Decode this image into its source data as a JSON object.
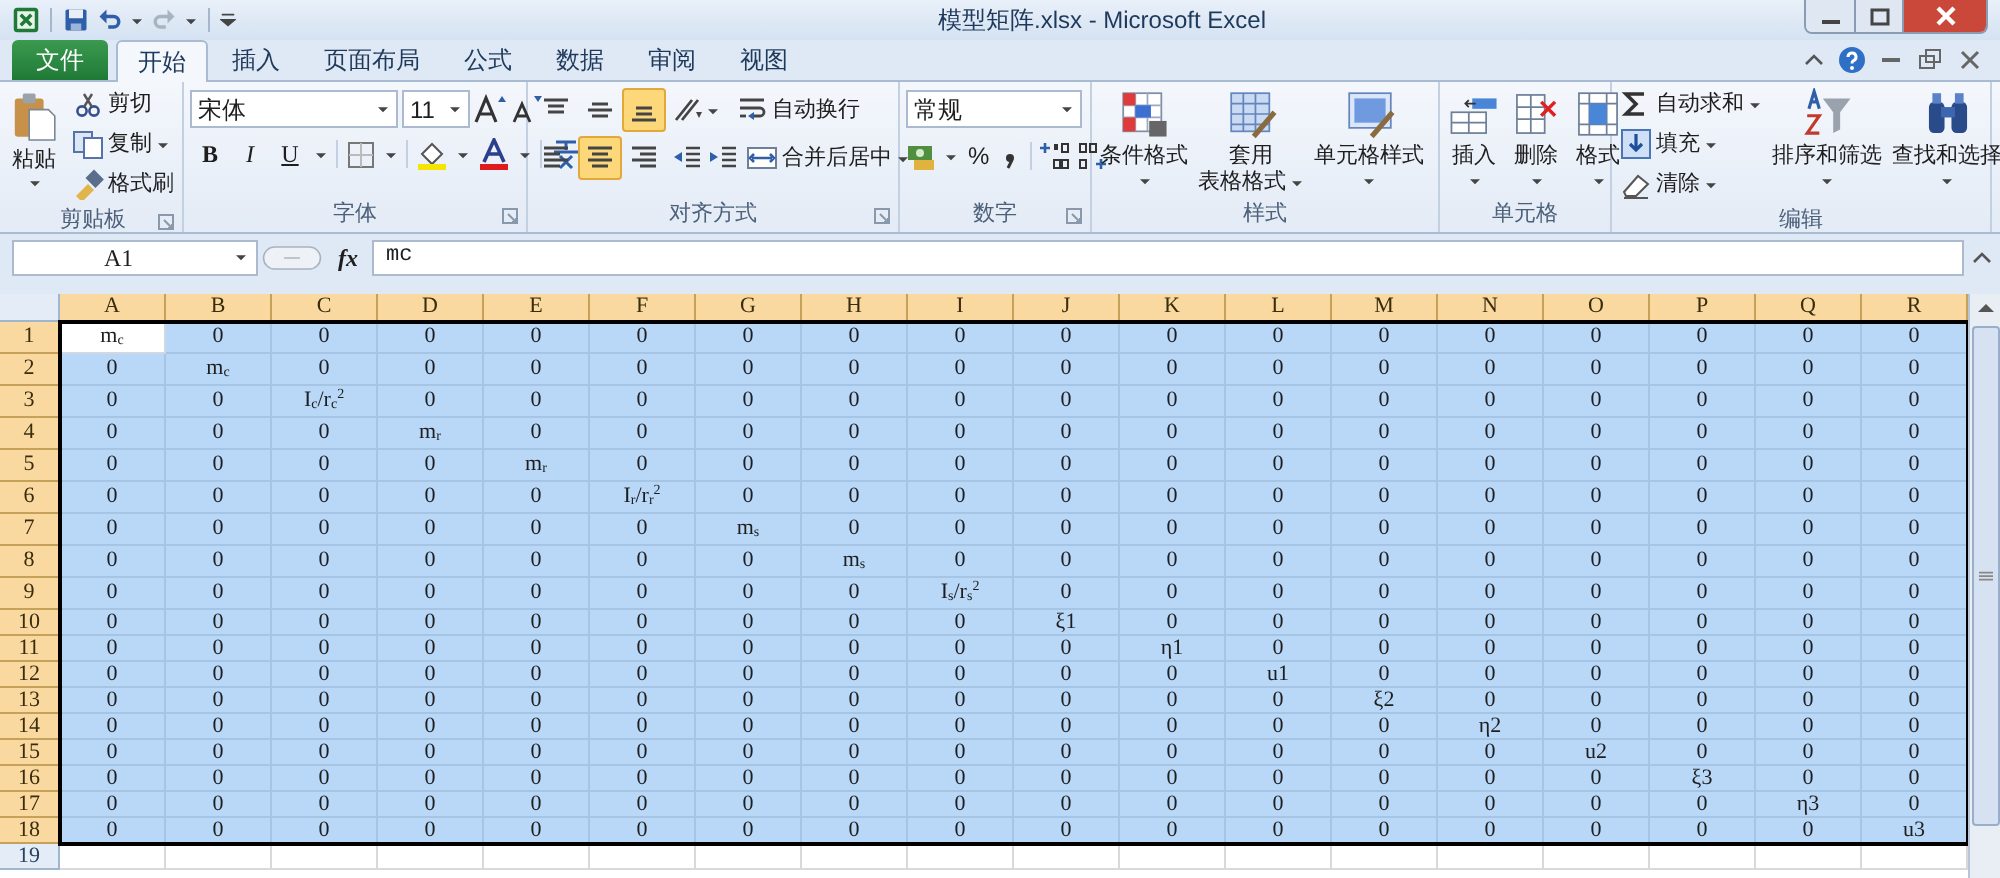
{
  "window": {
    "title": "模型矩阵.xlsx - Microsoft Excel"
  },
  "tabs": [
    {
      "label": "文件",
      "kind": "file",
      "selected": false
    },
    {
      "label": "开始",
      "kind": "tab",
      "selected": true
    },
    {
      "label": "插入",
      "kind": "tab",
      "selected": false
    },
    {
      "label": "页面布局",
      "kind": "tab",
      "selected": false
    },
    {
      "label": "公式",
      "kind": "tab",
      "selected": false
    },
    {
      "label": "数据",
      "kind": "tab",
      "selected": false
    },
    {
      "label": "审阅",
      "kind": "tab",
      "selected": false
    },
    {
      "label": "视图",
      "kind": "tab",
      "selected": false
    }
  ],
  "ribbon": {
    "groups": [
      {
        "kind": "clipboard",
        "label": "剪贴板",
        "large_button": "粘贴",
        "small_buttons": [
          "剪切",
          "复制",
          "格式刷"
        ]
      },
      {
        "kind": "font",
        "label": "字体",
        "font_name": "宋体",
        "font_size": "11",
        "style_buttons": [
          "B",
          "I",
          "U"
        ]
      },
      {
        "kind": "alignment",
        "label": "对齐方式",
        "vertical_align": [
          {
            "selected": false
          },
          {
            "selected": false
          },
          {
            "selected": true
          }
        ],
        "horizontal_align": [
          {
            "selected": false
          },
          {
            "selected": true
          },
          {
            "selected": false
          }
        ],
        "wrap_text": "自动换行",
        "merge_center": "合并后居中"
      },
      {
        "kind": "number",
        "label": "数字",
        "format": "常规",
        "percent": "%"
      },
      {
        "kind": "styles",
        "label": "样式",
        "buttons": [
          [
            "条件格式"
          ],
          [
            "套用",
            "表格格式"
          ],
          [
            "单元格样式"
          ]
        ]
      },
      {
        "kind": "cells",
        "label": "单元格",
        "buttons": [
          "插入",
          "删除",
          "格式"
        ]
      },
      {
        "kind": "editing",
        "label": "编辑",
        "small_buttons": [
          "自动求和",
          "填充",
          "清除"
        ],
        "large_buttons": [
          "排序和筛选",
          "查找和选择"
        ]
      }
    ]
  },
  "formula_bar": {
    "name_box": "A1",
    "fx": "fx",
    "content": "mc"
  },
  "columns": [
    {
      "label": "A",
      "selected": true
    },
    {
      "label": "B",
      "selected": true
    },
    {
      "label": "C",
      "selected": true
    },
    {
      "label": "D",
      "selected": true
    },
    {
      "label": "E",
      "selected": true
    },
    {
      "label": "F",
      "selected": true
    },
    {
      "label": "G",
      "selected": true
    },
    {
      "label": "H",
      "selected": true
    },
    {
      "label": "I",
      "selected": true
    },
    {
      "label": "J",
      "selected": true
    },
    {
      "label": "K",
      "selected": true
    },
    {
      "label": "L",
      "selected": true
    },
    {
      "label": "M",
      "selected": true
    },
    {
      "label": "N",
      "selected": true
    },
    {
      "label": "O",
      "selected": true
    },
    {
      "label": "P",
      "selected": true
    },
    {
      "label": "Q",
      "selected": true
    },
    {
      "label": "R",
      "selected": true
    }
  ],
  "rows": [
    {
      "header": "1",
      "selected": true,
      "cells": [
        "m$_{c}$",
        "0",
        "0",
        "0",
        "0",
        "0",
        "0",
        "0",
        "0",
        "0",
        "0",
        "0",
        "0",
        "0",
        "0",
        "0",
        "0",
        "0"
      ]
    },
    {
      "header": "2",
      "selected": true,
      "cells": [
        "0",
        "m$_{c}$",
        "0",
        "0",
        "0",
        "0",
        "0",
        "0",
        "0",
        "0",
        "0",
        "0",
        "0",
        "0",
        "0",
        "0",
        "0",
        "0"
      ]
    },
    {
      "header": "3",
      "selected": true,
      "cells": [
        "0",
        "0",
        "I$_{c}$/r$_{c}$$^{2}$",
        "0",
        "0",
        "0",
        "0",
        "0",
        "0",
        "0",
        "0",
        "0",
        "0",
        "0",
        "0",
        "0",
        "0",
        "0"
      ]
    },
    {
      "header": "4",
      "selected": true,
      "cells": [
        "0",
        "0",
        "0",
        "m$_{r}$",
        "0",
        "0",
        "0",
        "0",
        "0",
        "0",
        "0",
        "0",
        "0",
        "0",
        "0",
        "0",
        "0",
        "0"
      ]
    },
    {
      "header": "5",
      "selected": true,
      "cells": [
        "0",
        "0",
        "0",
        "0",
        "m$_{r}$",
        "0",
        "0",
        "0",
        "0",
        "0",
        "0",
        "0",
        "0",
        "0",
        "0",
        "0",
        "0",
        "0"
      ]
    },
    {
      "header": "6",
      "selected": true,
      "cells": [
        "0",
        "0",
        "0",
        "0",
        "0",
        "I$_{r}$/r$_{r}$$^{2}$",
        "0",
        "0",
        "0",
        "0",
        "0",
        "0",
        "0",
        "0",
        "0",
        "0",
        "0",
        "0"
      ]
    },
    {
      "header": "7",
      "selected": true,
      "cells": [
        "0",
        "0",
        "0",
        "0",
        "0",
        "0",
        "m$_{s}$",
        "0",
        "0",
        "0",
        "0",
        "0",
        "0",
        "0",
        "0",
        "0",
        "0",
        "0"
      ]
    },
    {
      "header": "8",
      "selected": true,
      "cells": [
        "0",
        "0",
        "0",
        "0",
        "0",
        "0",
        "0",
        "m$_{s}$",
        "0",
        "0",
        "0",
        "0",
        "0",
        "0",
        "0",
        "0",
        "0",
        "0"
      ]
    },
    {
      "header": "9",
      "selected": true,
      "cells": [
        "0",
        "0",
        "0",
        "0",
        "0",
        "0",
        "0",
        "0",
        "I$_{s}$/r$_{s}$$^{2}$",
        "0",
        "0",
        "0",
        "0",
        "0",
        "0",
        "0",
        "0",
        "0"
      ]
    },
    {
      "header": "10",
      "selected": true,
      "cells": [
        "0",
        "0",
        "0",
        "0",
        "0",
        "0",
        "0",
        "0",
        "0",
        "ξ1",
        "0",
        "0",
        "0",
        "0",
        "0",
        "0",
        "0",
        "0"
      ]
    },
    {
      "header": "11",
      "selected": true,
      "cells": [
        "0",
        "0",
        "0",
        "0",
        "0",
        "0",
        "0",
        "0",
        "0",
        "0",
        "η1",
        "0",
        "0",
        "0",
        "0",
        "0",
        "0",
        "0"
      ]
    },
    {
      "header": "12",
      "selected": true,
      "cells": [
        "0",
        "0",
        "0",
        "0",
        "0",
        "0",
        "0",
        "0",
        "0",
        "0",
        "0",
        "u1",
        "0",
        "0",
        "0",
        "0",
        "0",
        "0"
      ]
    },
    {
      "header": "13",
      "selected": true,
      "cells": [
        "0",
        "0",
        "0",
        "0",
        "0",
        "0",
        "0",
        "0",
        "0",
        "0",
        "0",
        "0",
        "ξ2",
        "0",
        "0",
        "0",
        "0",
        "0"
      ]
    },
    {
      "header": "14",
      "selected": true,
      "cells": [
        "0",
        "0",
        "0",
        "0",
        "0",
        "0",
        "0",
        "0",
        "0",
        "0",
        "0",
        "0",
        "0",
        "η2",
        "0",
        "0",
        "0",
        "0"
      ]
    },
    {
      "header": "15",
      "selected": true,
      "cells": [
        "0",
        "0",
        "0",
        "0",
        "0",
        "0",
        "0",
        "0",
        "0",
        "0",
        "0",
        "0",
        "0",
        "0",
        "u2",
        "0",
        "0",
        "0"
      ]
    },
    {
      "header": "16",
      "selected": true,
      "cells": [
        "0",
        "0",
        "0",
        "0",
        "0",
        "0",
        "0",
        "0",
        "0",
        "0",
        "0",
        "0",
        "0",
        "0",
        "0",
        "ξ3",
        "0",
        "0"
      ]
    },
    {
      "header": "17",
      "selected": true,
      "cells": [
        "0",
        "0",
        "0",
        "0",
        "0",
        "0",
        "0",
        "0",
        "0",
        "0",
        "0",
        "0",
        "0",
        "0",
        "0",
        "0",
        "η3",
        "0"
      ]
    },
    {
      "header": "18",
      "selected": true,
      "cells": [
        "0",
        "0",
        "0",
        "0",
        "0",
        "0",
        "0",
        "0",
        "0",
        "0",
        "0",
        "0",
        "0",
        "0",
        "0",
        "0",
        "0",
        "u3"
      ]
    },
    {
      "header": "19",
      "selected": false
    }
  ]
}
